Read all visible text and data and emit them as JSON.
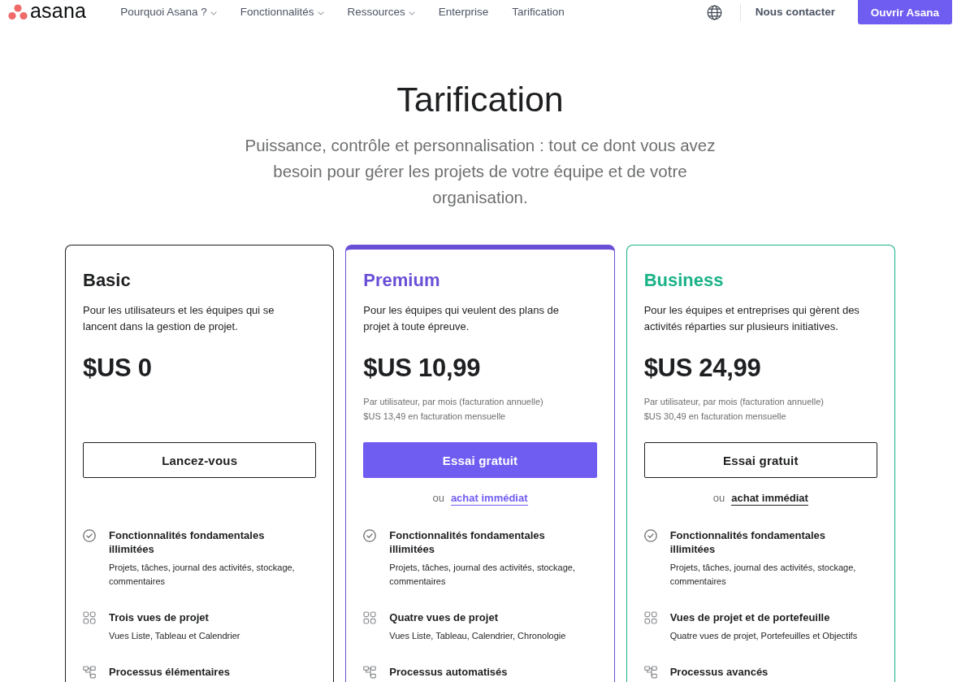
{
  "nav": {
    "logo": "asana",
    "items": [
      {
        "label": "Pourquoi Asana ?",
        "has_dropdown": true
      },
      {
        "label": "Fonctionnalités",
        "has_dropdown": true
      },
      {
        "label": "Ressources",
        "has_dropdown": true
      },
      {
        "label": "Enterprise",
        "has_dropdown": false
      },
      {
        "label": "Tarification",
        "has_dropdown": false
      }
    ],
    "contact": "Nous contacter",
    "cta": "Ouvrir Asana"
  },
  "hero": {
    "title": "Tarification",
    "subtitle": "Puissance, contrôle et personnalisation : tout ce dont vous avez besoin pour gérer les projets de votre équipe et de votre organisation."
  },
  "plans": [
    {
      "name": "Basic",
      "color": "#1e1f21",
      "highlighted": false,
      "description": "Pour les utilisateurs et les équipes qui se lancent dans la gestion de projet.",
      "price": "$US 0",
      "button": {
        "label": "Lancez-vous",
        "kind": "secondary"
      },
      "features": [
        {
          "kind": "check",
          "title": "Fonctionnalités fondamentales illimitées",
          "detail": "Projets, tâches, journal des activités, stockage, commentaires"
        },
        {
          "kind": "views",
          "title": "Trois vues de projet",
          "detail": "Vues Liste, Tableau et Calendrier"
        },
        {
          "kind": "workflow",
          "title": "Processus élémentaires"
        }
      ]
    },
    {
      "name": "Premium",
      "color": "#6a4fd6",
      "highlighted": true,
      "description": "Pour les équipes qui veulent des plans de projet à toute épreuve.",
      "price": "$US 10,99",
      "price_notes": [
        "Par utilisateur, par mois (facturation annuelle)",
        "$US 13,49 en facturation mensuelle"
      ],
      "button": {
        "label": "Essai gratuit",
        "kind": "primary"
      },
      "alternative": {
        "prefix": "ou",
        "link": "achat immédiat"
      },
      "features": [
        {
          "kind": "check",
          "title": "Fonctionnalités fondamentales illimitées",
          "detail": "Projets, tâches, journal des activités, stockage, commentaires"
        },
        {
          "kind": "views",
          "title": "Quatre vues de projet",
          "detail": "Vues Liste, Tableau, Calendrier, Chronologie"
        },
        {
          "kind": "workflow",
          "title": "Processus automatisés"
        }
      ]
    },
    {
      "name": "Business",
      "color": "#1ab288",
      "highlighted": false,
      "description": "Pour les équipes et entreprises qui gèrent des activités réparties sur plusieurs initiatives.",
      "price": "$US 24,99",
      "price_notes": [
        "Par utilisateur, par mois (facturation annuelle)",
        "$US 30,49 en facturation mensuelle"
      ],
      "button": {
        "label": "Essai gratuit",
        "kind": "secondary"
      },
      "alternative": {
        "prefix": "ou",
        "link": "achat immédiat"
      },
      "features": [
        {
          "kind": "check",
          "title": "Fonctionnalités fondamentales illimitées",
          "detail": "Projets, tâches, journal des activités, stockage, commentaires"
        },
        {
          "kind": "views",
          "title": "Vues de projet et de portefeuille",
          "detail": "Quatre vues de projet, Portefeuilles et Objectifs"
        },
        {
          "kind": "workflow",
          "title": "Processus avancés"
        }
      ]
    }
  ]
}
